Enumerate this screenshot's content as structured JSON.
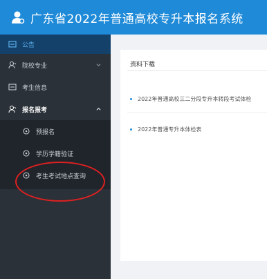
{
  "header": {
    "title": "广东省2022年普通高校专升本报名系统",
    "logo_icon": "user-logo-icon",
    "bg_color": "#1f8ad8"
  },
  "sidebar": {
    "items": [
      {
        "label": "公告",
        "icon": "notice-icon",
        "active": true
      },
      {
        "label": "院校专业",
        "icon": "school-icon",
        "expandable": true,
        "expanded": false
      },
      {
        "label": "考生信息",
        "icon": "card-icon"
      },
      {
        "label": "报名报考",
        "icon": "apply-icon",
        "expandable": true,
        "expanded": true,
        "children": [
          {
            "label": "预报名",
            "icon": "circle-icon"
          },
          {
            "label": "学历学籍验证",
            "icon": "circle-icon"
          },
          {
            "label": "考生考试地点查询",
            "icon": "circle-icon",
            "highlighted": true
          }
        ]
      }
    ],
    "active_color": "#5eb0f0",
    "highlight_color": "#e02020"
  },
  "main": {
    "section_title": "资料下载",
    "documents": [
      "2022年普通高校三二分段专升本转段考试体检",
      "2022年普通专升本体检表"
    ]
  }
}
